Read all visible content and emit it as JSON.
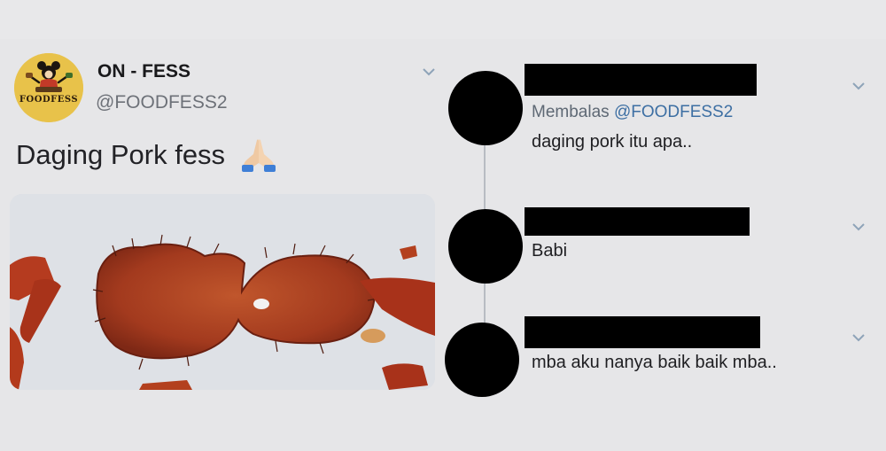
{
  "tweet": {
    "display_name": "ON - FESS",
    "handle": "@FOODFESS2",
    "logo_text": "FOODFESS",
    "text": "Daging Pork fess",
    "emoji": "folded-hands-emoji",
    "media": "photo-of-red-fried-pork"
  },
  "replies": [
    {
      "meta_prefix": "Membalas",
      "mention": "@FOODFESS2",
      "text": "daging pork itu apa.."
    },
    {
      "text": "Babi"
    },
    {
      "text": "mba aku nanya baik baik mba.."
    }
  ],
  "icons": {
    "menu": "chevron-down-icon",
    "avatar_redacted": "black-circle",
    "name_redacted": "black-bar"
  },
  "colors": {
    "background": "#e6e6e8",
    "mention": "#3d6fa3",
    "secondary_text": "#6d7178",
    "logo_bg": "#e8c24a"
  }
}
